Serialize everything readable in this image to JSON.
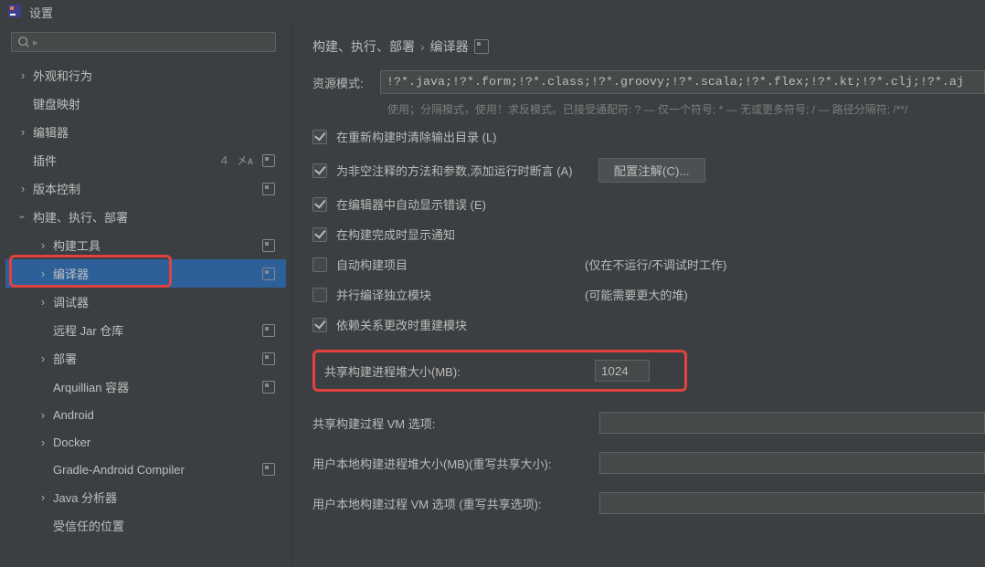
{
  "window_title": "设置",
  "search_placeholder": "",
  "tree": {
    "appearance": "外观和行为",
    "keymap": "键盘映射",
    "editor": "编辑器",
    "plugins": "插件",
    "plugins_count": "4",
    "version_control": "版本控制",
    "build": "构建、执行、部署",
    "build_tools": "构建工具",
    "compiler": "编译器",
    "debugger": "调试器",
    "remote_jar": "远程 Jar 仓库",
    "deployment": "部署",
    "arquillian": "Arquillian 容器",
    "android": "Android",
    "docker": "Docker",
    "gradle_android": "Gradle-Android Compiler",
    "java_analyzer": "Java 分析器",
    "trusted_locations": "受信任的位置"
  },
  "breadcrumb": {
    "build": "构建、执行、部署",
    "compiler": "编译器"
  },
  "resource": {
    "label": "资源模式:",
    "value": "!?*.java;!?*.form;!?*.class;!?*.groovy;!?*.scala;!?*.flex;!?*.kt;!?*.clj;!?*.aj",
    "hint": "使用；分隔模式，使用！求反模式。已接受通配符: ? — 仅一个符号; * — 无或更多符号; / — 路径分隔符; /**/"
  },
  "opts": {
    "clear_output": "在重新构建时清除输出目录 (L)",
    "nonempty_assert": "为非空注释的方法和参数,添加运行时断言 (A)",
    "configure_btn": "配置注解(C)...",
    "show_errors_editor": "在编辑器中自动显示错误 (E)",
    "show_notifications": "在构建完成时显示通知",
    "auto_build": "自动构建项目",
    "auto_build_note": "(仅在不运行/不调试时工作)",
    "parallel": "并行编译独立模块",
    "parallel_note": "(可能需要更大的堆)",
    "rebuild_deps": "依赖关系更改时重建模块"
  },
  "heap": {
    "shared_heap_label": "共享构建进程堆大小(MB):",
    "shared_heap_value": "1024",
    "shared_vm_label": "共享构建过程 VM 选项:",
    "user_heap_label": "用户本地构建进程堆大小(MB)(重写共享大小):",
    "user_vm_label": "用户本地构建过程 VM 选项 (重写共享选项):"
  }
}
